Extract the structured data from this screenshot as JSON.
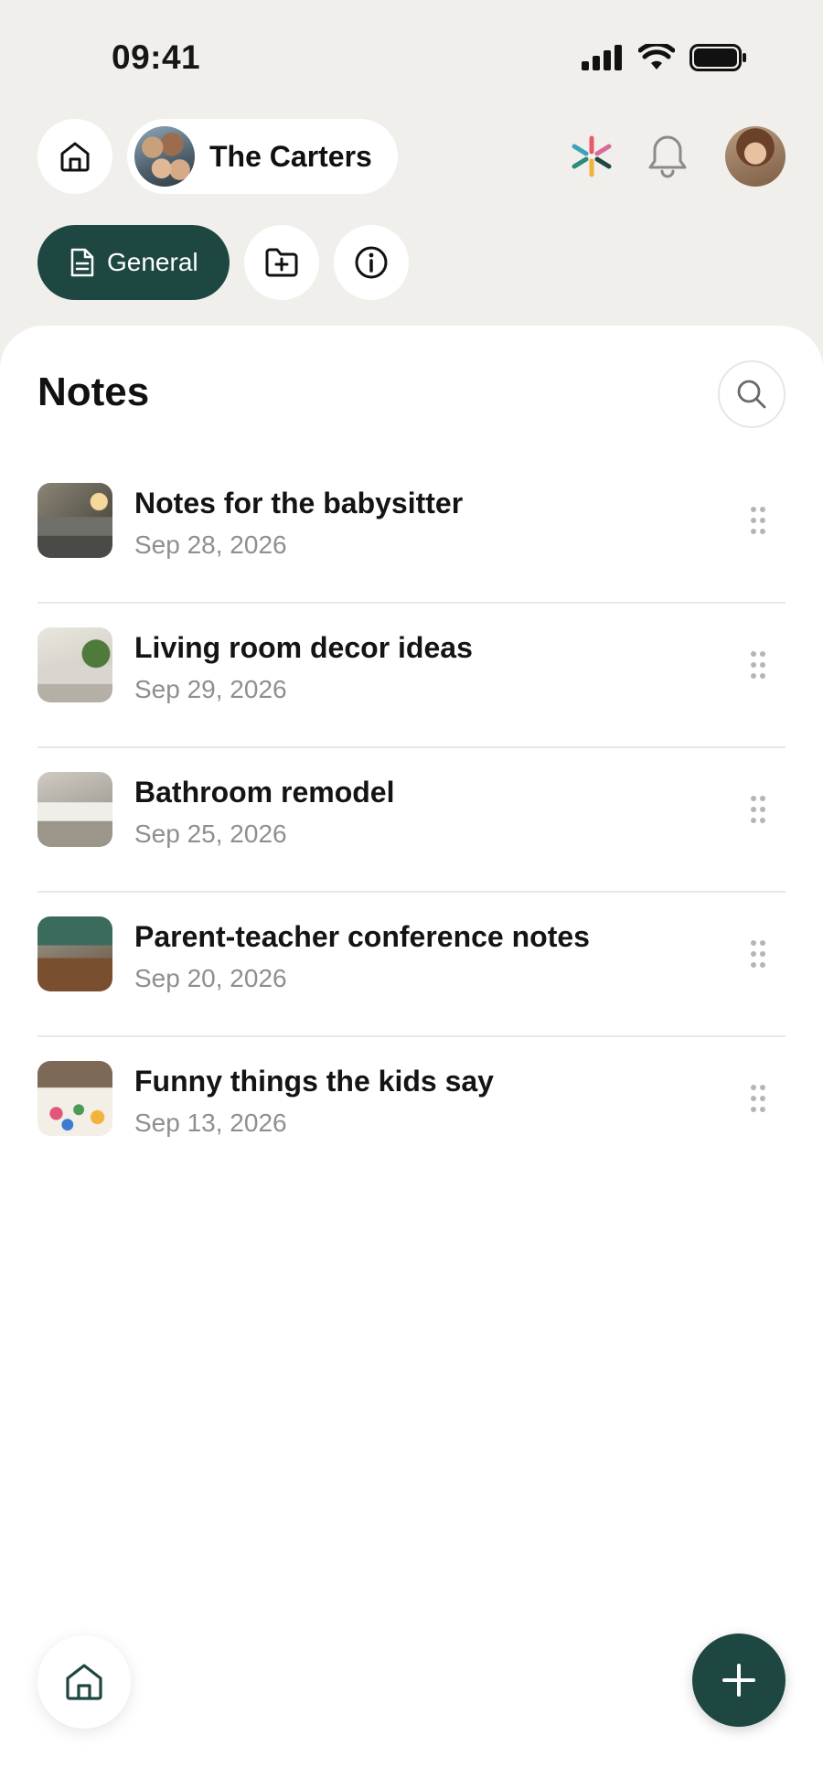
{
  "status_bar": {
    "time": "09:41"
  },
  "header": {
    "family_name": "The Carters"
  },
  "tabs": {
    "general_label": "General"
  },
  "notes": {
    "title": "Notes",
    "items": [
      {
        "title": "Notes for the babysitter",
        "date": "Sep 28, 2026"
      },
      {
        "title": "Living room decor ideas",
        "date": "Sep 29, 2026"
      },
      {
        "title": "Bathroom remodel",
        "date": "Sep 25, 2026"
      },
      {
        "title": "Parent-teacher conference notes",
        "date": "Sep 20, 2026"
      },
      {
        "title": "Funny things the kids say",
        "date": "Sep 13, 2026"
      }
    ]
  },
  "colors": {
    "accent": "#1e4741",
    "background": "#f1efec",
    "muted_text": "#8f8f8f"
  },
  "icons": [
    "home-icon",
    "sparkle-icon",
    "bell-icon",
    "document-icon",
    "folder-plus-icon",
    "info-icon",
    "search-icon",
    "drag-handle-icon",
    "plus-icon"
  ]
}
